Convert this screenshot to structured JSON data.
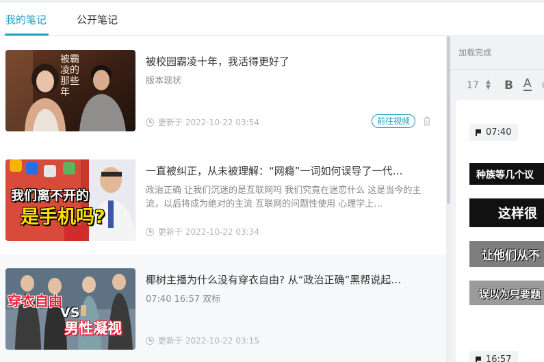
{
  "tabs": [
    {
      "label": "我的笔记",
      "active": true
    },
    {
      "label": "公开笔记",
      "active": false
    }
  ],
  "notes": [
    {
      "title": "被校园霸凌十年，我活得更好了",
      "desc": "版本现状",
      "updated": "更新于 2022-10-22 03:54",
      "go_label": "前往视频",
      "thumb_text": "被霸凌的那些年"
    },
    {
      "title": "一直被纠正，从未被理解：“网瘾”一词如何误导了一代…",
      "desc": "政治正确 让我们沉迷的是互联网吗 我们究竟在迷恋什么 这是当今的主流，以后将成为绝对的主流 互联网的问题性使用 心理学上…",
      "updated": "更新于 2022-10-22 03:34",
      "thumb_line1": "我们离不开的",
      "thumb_line2": "是手机吗?"
    },
    {
      "title": "椰树主播为什么没有穿衣自由? 从“政治正确”黑帮说起…",
      "desc": "07:40 16:57 双标",
      "updated": "更新于 2022-10-22 03:15",
      "thumb_left": "穿衣自由",
      "thumb_vs": "VS",
      "thumb_right": "男性凝视"
    }
  ],
  "editor": {
    "status": "加载完成",
    "font_size": "17",
    "bold_label": "B",
    "color_label": "A",
    "more_label": "≡",
    "timestamps": [
      "07:40",
      "16:57"
    ],
    "screenshot_texts": [
      "种族等几个议",
      "这样很",
      "让他们从不",
      "误以为只要题"
    ]
  },
  "colors": {
    "accent": "#1a9fbf",
    "thumb2_yellow": "#ffe100",
    "thumb3_red": "#e8233a"
  }
}
